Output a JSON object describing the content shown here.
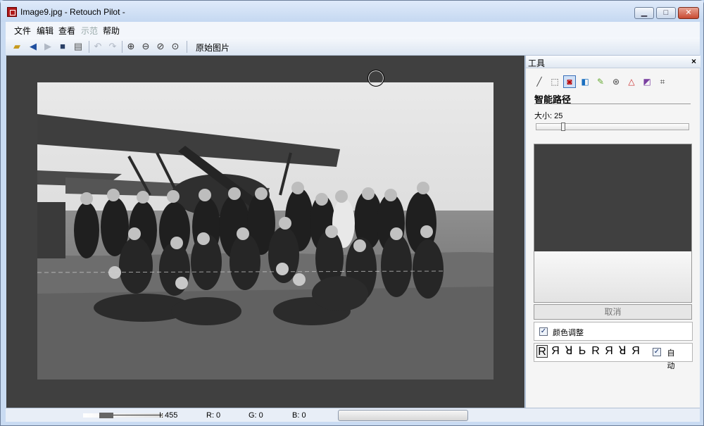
{
  "window": {
    "title": "Image9.jpg - Retouch Pilot -",
    "min_glyph": "▁",
    "max_glyph": "□",
    "close_glyph": "✕"
  },
  "menu": [
    "文件",
    "编辑",
    "查看",
    "示范",
    "帮助"
  ],
  "toolbar": {
    "original_image": "原始图片",
    "icons": [
      "open-icon",
      "back-icon",
      "forward-icon",
      "save-icon",
      "print-icon",
      "undo-icon",
      "redo-icon",
      "zoom-in-icon",
      "zoom-out-icon",
      "zoom-fit-icon",
      "zoom-actual-icon"
    ]
  },
  "panel": {
    "header": "工具",
    "close": "×",
    "tool_name": "智能路径",
    "size_label": "大小: 25",
    "size_value": 25,
    "cancel": "取消",
    "color_adjust": "颜色调整",
    "color_adjust_checked": true,
    "auto": "自动",
    "auto_checked": true,
    "glyphs": [
      "R",
      "Я",
      "ꓤ",
      "Ь",
      "R",
      "Я",
      "ꓤ",
      "Я"
    ]
  },
  "status": {
    "zoom": "455",
    "r": "R: 0",
    "g": "G: 0",
    "b": "B: 0"
  },
  "colors": {
    "canvas_bg": "#404040",
    "chrome": "#c9dbf2",
    "panel_bg": "#f5f5f5"
  }
}
